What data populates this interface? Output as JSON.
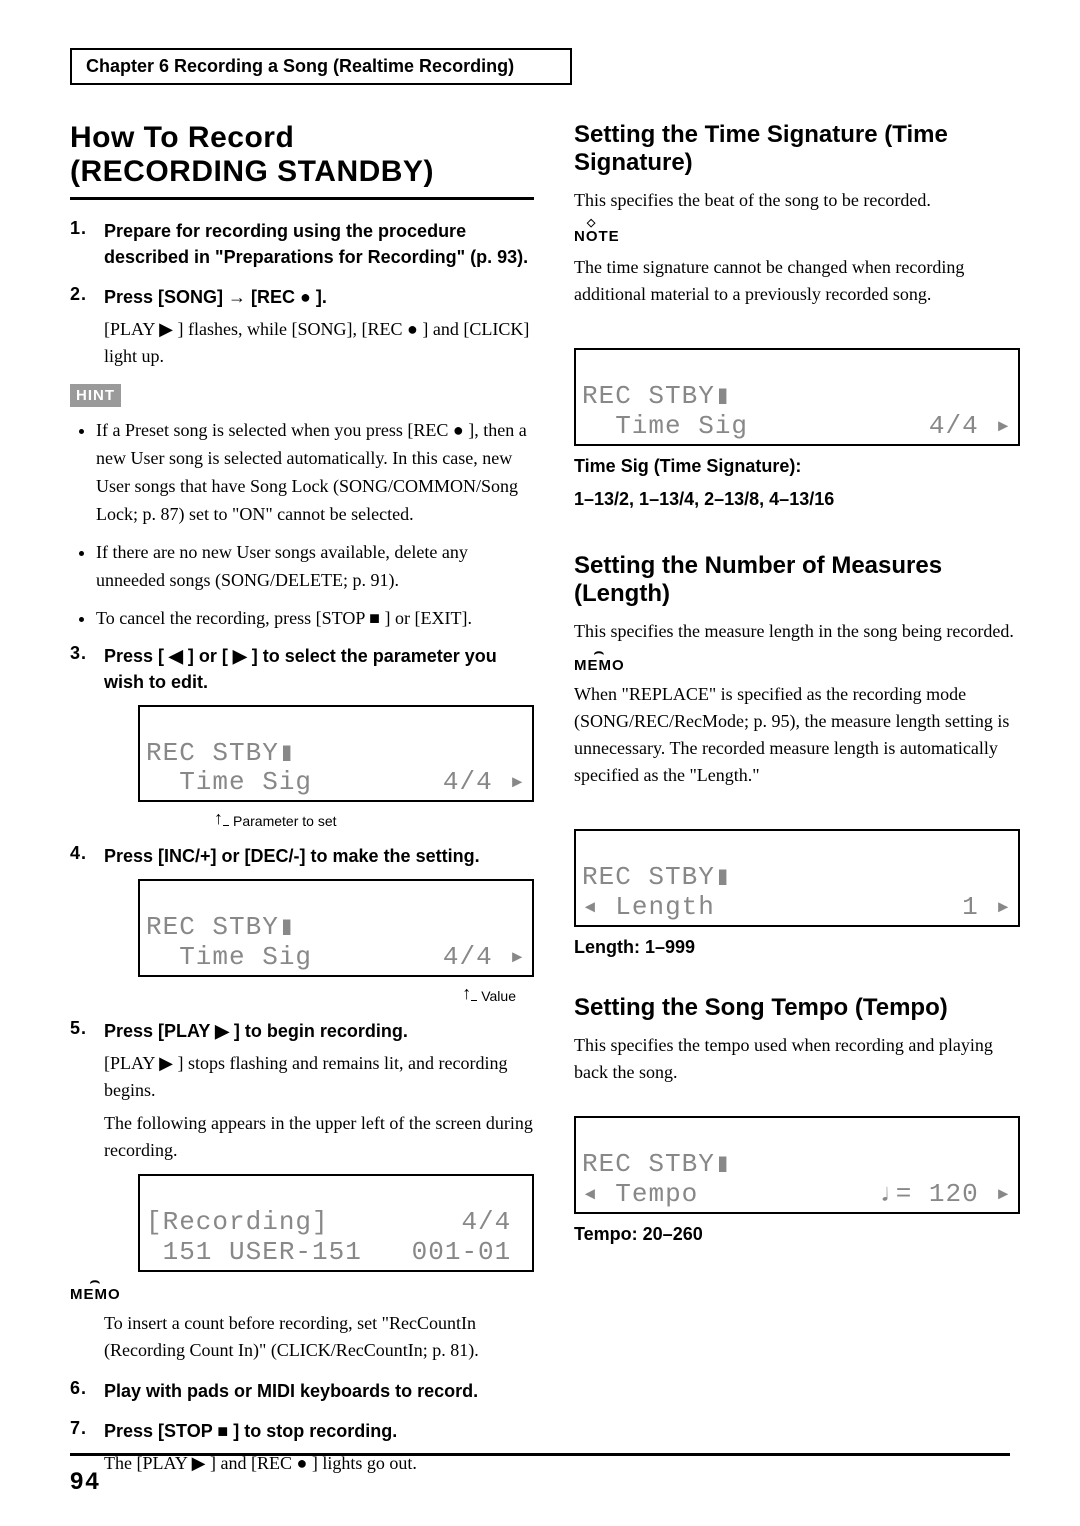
{
  "chapter_header": "Chapter 6 Recording a Song (Realtime Recording)",
  "page_number": "94",
  "left": {
    "title_line1": "How To Record",
    "title_line2": "(RECORDING STANDBY)",
    "steps": {
      "s1": "Prepare for recording using the procedure described in \"Preparations for Recording\" (p. 93).",
      "s2_head": "Press [SONG] → [REC ● ].",
      "s2_body": "[PLAY ▶ ] flashes, while [SONG], [REC ● ] and [CLICK] light up.",
      "hint_label": "HINT",
      "bullets": [
        "If a Preset song is selected when you press [REC ● ], then a new User song is selected automatically. In this case, new User songs that have Song Lock (SONG/COMMON/Song Lock; p. 87) set to \"ON\" cannot be selected.",
        "If there are no new User songs available, delete any unneeded songs (SONG/DELETE; p. 91).",
        "To cancel the recording, press [STOP ■ ] or [EXIT]."
      ],
      "s3_head": "Press [ ◀ ] or [ ▶ ] to select the parameter you wish to edit.",
      "lcd1_line1": "REC STBY▮",
      "lcd1_line2a": "  Time Sig",
      "lcd1_line2b": "4/4 ▸",
      "param_label": "Parameter to set",
      "s4_head": "Press [INC/+] or [DEC/-] to make the setting.",
      "lcd2_line1": "REC STBY▮",
      "lcd2_line2a": "  Time Sig",
      "lcd2_line2b": "4/4 ▸",
      "value_label": "Value",
      "s5_head": "Press [PLAY ▶ ] to begin recording.",
      "s5_body1": "[PLAY ▶ ] stops flashing and remains lit, and recording begins.",
      "s5_body2": "The following appears in the upper left of the screen during recording.",
      "lcd3_line1": "[Recording]        4/4",
      "lcd3_line2": " 151 USER-151   001-01",
      "memo_label": "MEMO",
      "memo_text": "To insert a count before recording, set \"RecCountIn (Recording Count In)\" (CLICK/RecCountIn; p. 81).",
      "s6_head": "Play with pads or MIDI keyboards to record.",
      "s7_head": "Press [STOP ■ ] to stop recording.",
      "s7_body": "The [PLAY ▶ ] and [REC ● ] lights go out."
    }
  },
  "right": {
    "timesig": {
      "title": "Setting the Time Signature (Time Signature)",
      "intro": "This specifies the beat of the song to be recorded.",
      "note_label": "NOTE",
      "note_text": "The time signature cannot be changed when recording additional material to a previously recorded song.",
      "lcd_line1": "REC STBY▮",
      "lcd_line2a": "  Time Sig",
      "lcd_line2b": "4/4 ▸",
      "param_head": "Time Sig (Time Signature):",
      "param_vals": "1–13/2, 1–13/4, 2–13/8, 4–13/16"
    },
    "length": {
      "title": "Setting the Number of Measures (Length)",
      "intro": "This specifies the measure length in the song being recorded.",
      "memo_label": "MEMO",
      "memo_text": "When \"REPLACE\" is specified as the recording mode (SONG/REC/RecMode; p. 95), the measure length setting is unnecessary. The recorded measure length is automatically specified as the \"Length.\"",
      "lcd_line1": "REC STBY▮",
      "lcd_line2a": "◂ Length",
      "lcd_line2b": "1 ▸",
      "param": "Length: 1–999"
    },
    "tempo": {
      "title": "Setting the Song Tempo (Tempo)",
      "intro": "This specifies the tempo used when recording and playing back the song.",
      "lcd_line1": "REC STBY▮",
      "lcd_line2a": "◂ Tempo",
      "lcd_line2b": "♩= 120 ▸",
      "param": "Tempo: 20–260"
    }
  }
}
